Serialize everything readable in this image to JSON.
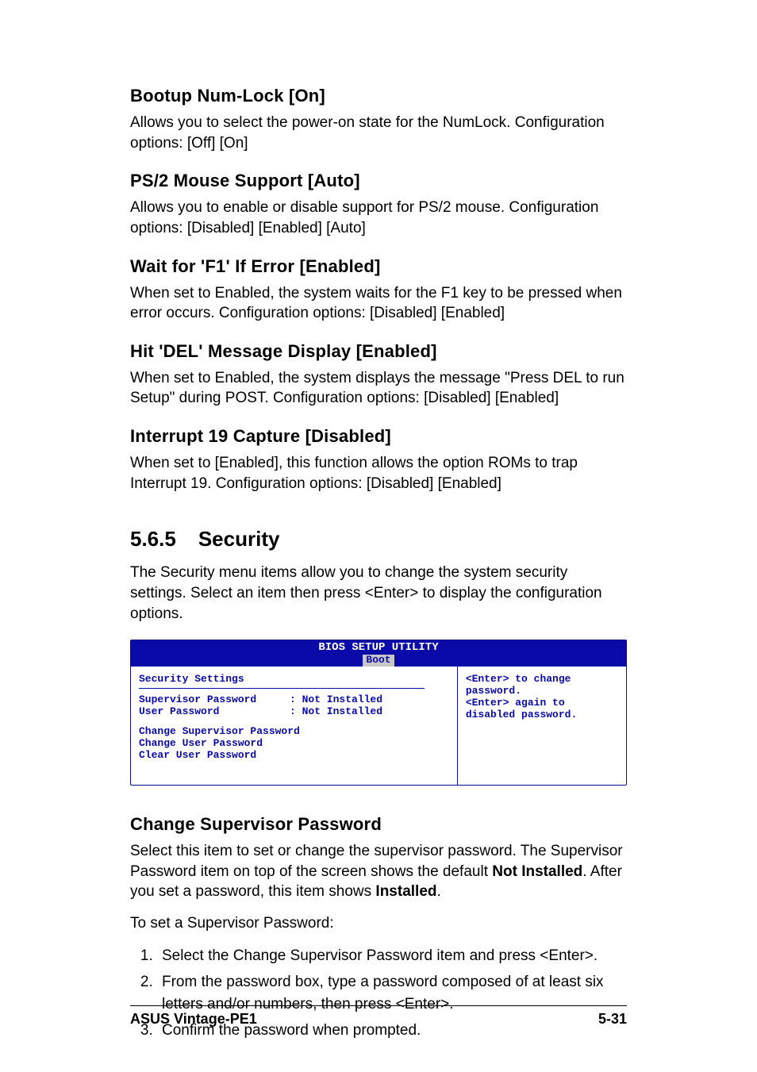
{
  "sections": [
    {
      "title": "Bootup Num-Lock [On]",
      "body": "Allows you to select the power-on state for the NumLock. Configuration options: [Off] [On]"
    },
    {
      "title": "PS/2 Mouse Support [Auto]",
      "body": "Allows you to enable or disable support for PS/2 mouse. Configuration options: [Disabled] [Enabled] [Auto]"
    },
    {
      "title": "Wait for 'F1' If Error [Enabled]",
      "body": "When set to Enabled, the system waits for the F1 key to be pressed when error occurs. Configuration options: [Disabled] [Enabled]"
    },
    {
      "title": "Hit 'DEL' Message Display [Enabled]",
      "body": "When set to Enabled, the system displays the message \"Press DEL to run Setup\" during POST. Configuration options: [Disabled] [Enabled]"
    },
    {
      "title": "Interrupt 19 Capture [Disabled]",
      "body": "When set to [Enabled], this function allows the option ROMs to trap Interrupt 19. Configuration options: [Disabled] [Enabled]"
    }
  ],
  "security": {
    "num": "5.6.5",
    "title": "Security",
    "intro": "The Security menu items allow you to change the system security settings. Select an item then press <Enter> to display the configuration options."
  },
  "bios": {
    "titlebar": "BIOS SETUP UTILITY",
    "tab": "Boot",
    "section_title": "Security Settings",
    "kv": [
      {
        "k": "Supervisor Password",
        "v": ": Not Installed"
      },
      {
        "k": "User Password",
        "v": ": Not Installed"
      }
    ],
    "menu": [
      "Change Supervisor Password",
      "Change User Password",
      "Clear User Password"
    ],
    "help": [
      "<Enter> to change",
      "password.",
      "<Enter> again to",
      "disabled password."
    ]
  },
  "change_sup": {
    "title": "Change Supervisor Password",
    "p1_a": "Select this item to set or change the supervisor password. The Supervisor Password item on top of the screen shows the default ",
    "p1_b": "Not Installed",
    "p1_c": ". After you set a password, this item shows ",
    "p1_d": "Installed",
    "p1_e": ".",
    "p2": "To set a Supervisor Password:",
    "steps": [
      "Select the Change Supervisor Password item and press <Enter>.",
      "From the password box, type a password composed of at least six letters and/or numbers, then press <Enter>.",
      "Confirm the password when prompted."
    ]
  },
  "footer": {
    "left": "ASUS Vintage-PE1",
    "right": "5-31"
  }
}
